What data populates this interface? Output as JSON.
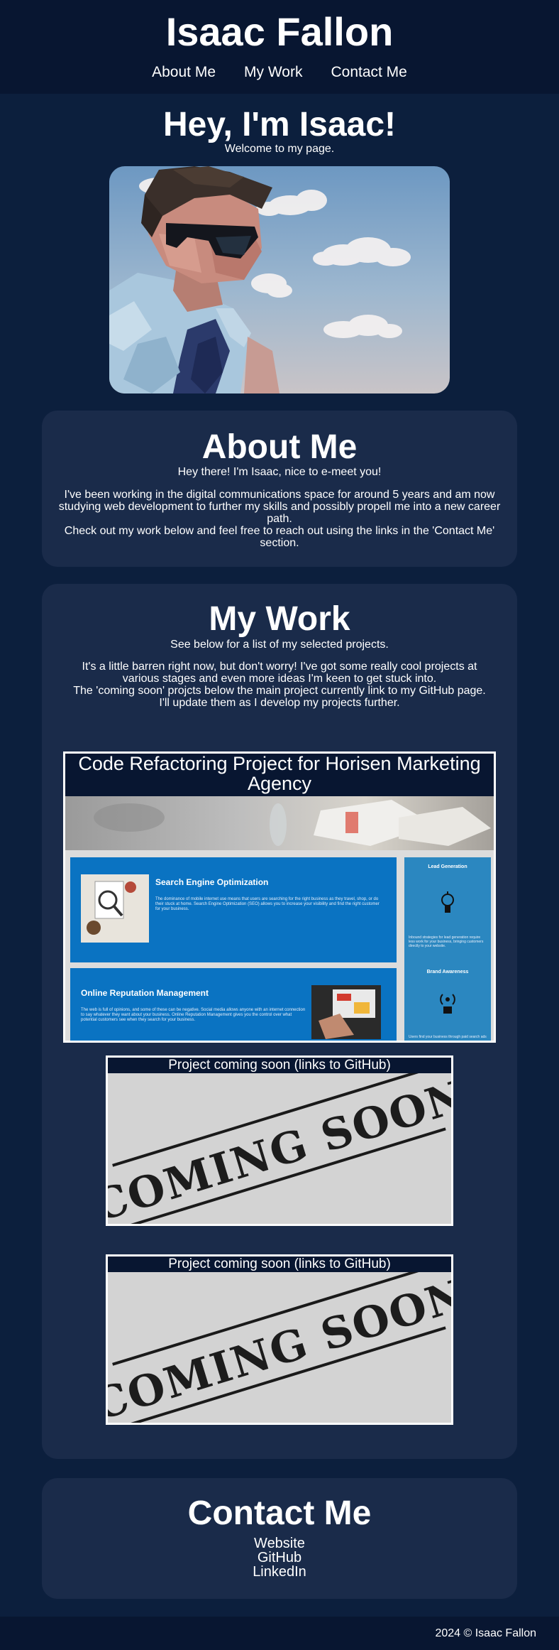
{
  "header": {
    "site_title": "Isaac Fallon",
    "nav": [
      "About Me",
      "My Work",
      "Contact Me"
    ]
  },
  "hero": {
    "title": "Hey, I'm Isaac!",
    "subtitle": "Welcome to my page."
  },
  "about": {
    "title": "About Me",
    "intro": "Hey there! I'm Isaac, nice to e-meet you!",
    "body_1": "I've been working in the digital communications space for around 5 years and am now studying web development to further my skills and possibly propell me into a new career path.",
    "body_2": "Check out my work below and feel free to reach out using the links in the 'Contact Me' section."
  },
  "work": {
    "title": "My Work",
    "intro": "See below for a list of my selected projects.",
    "body_1": "It's a little barren right now, but don't worry! I've got some really cool projects at various stages and even more ideas I'm keen to get stuck into.",
    "body_2": "The 'coming soon' projcts below the main project currently link to my GitHub page. I'll update them as I develop my projects further.",
    "projects": [
      {
        "title": "Code Refactoring Project for Horisen Marketing Agency",
        "screenshot": {
          "seo_title": "Search Engine Optimization",
          "seo_text": "The dominance of mobile internet use means that users are searching for the right business as they travel, shop, or do their stuck at home. Search Engine Optimization (SEO) allows you to increase your visibility and find the right customer for your business.",
          "orm_title": "Online Reputation Management",
          "orm_text": "The web is full of opinions, and some of these can be negative. Social media allows anyone with an internet connection to say whatever they want about your business. Online Reputation Management gives you the control over what potential customers see when they search for your business.",
          "lead_title": "Lead Generation",
          "lead_text": "Inbound strategies for lead generation require less work for your business, bringing customers directly to your website.",
          "brand_title": "Brand Awareness",
          "brand_text": "Users find your business through paid search ads"
        }
      },
      {
        "title": "Project coming soon (links to GitHub)",
        "stamp": "COMING SOON"
      },
      {
        "title": "Project coming soon (links to GitHub)",
        "stamp": "COMING SOON"
      }
    ]
  },
  "contact": {
    "title": "Contact Me",
    "links": [
      "Website",
      "GitHub",
      "LinkedIn"
    ]
  },
  "footer": {
    "copyright": "2024 © Isaac Fallon"
  }
}
